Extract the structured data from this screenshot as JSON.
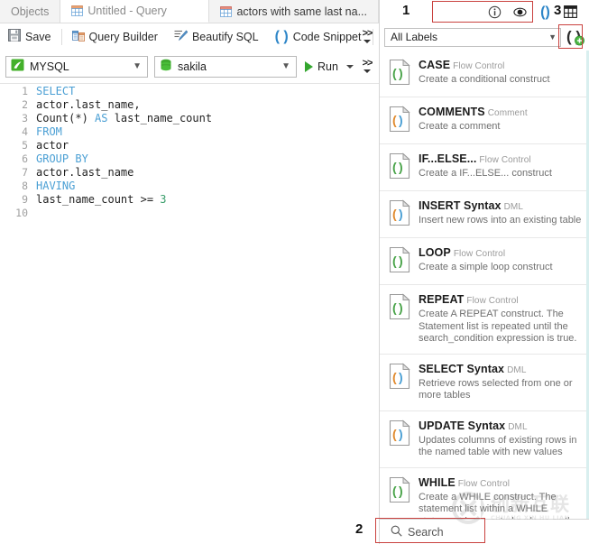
{
  "tabs": [
    {
      "label": "Objects",
      "icon": "none",
      "active": false
    },
    {
      "label": "Untitled - Query",
      "icon": "grid-orange-icon",
      "active": true
    },
    {
      "label": "actors with same last na...",
      "icon": "grid-red-icon",
      "active": false
    }
  ],
  "toolbar": {
    "save_label": "Save",
    "query_builder_label": "Query Builder",
    "beautify_label": "Beautify SQL",
    "code_snippet_label": "Code Snippet",
    "overflow_label": ">>"
  },
  "connection_bar": {
    "connection_value": "MYSQL",
    "database_value": "sakila",
    "run_label": "Run"
  },
  "editor": {
    "lines": [
      {
        "n": "1",
        "tokens": [
          {
            "t": "SELECT",
            "c": "kw"
          }
        ]
      },
      {
        "n": "2",
        "tokens": [
          {
            "t": "actor.last_name,",
            "c": ""
          }
        ]
      },
      {
        "n": "3",
        "tokens": [
          {
            "t": "Count(*) ",
            "c": ""
          },
          {
            "t": "AS",
            "c": "kw"
          },
          {
            "t": " last_name_count",
            "c": ""
          }
        ]
      },
      {
        "n": "4",
        "tokens": [
          {
            "t": "FROM",
            "c": "kw"
          }
        ]
      },
      {
        "n": "5",
        "tokens": [
          {
            "t": "actor",
            "c": ""
          }
        ]
      },
      {
        "n": "6",
        "tokens": [
          {
            "t": "GROUP BY",
            "c": "kw"
          }
        ]
      },
      {
        "n": "7",
        "tokens": [
          {
            "t": "actor.last_name",
            "c": ""
          }
        ]
      },
      {
        "n": "8",
        "tokens": [
          {
            "t": "HAVING",
            "c": "kw"
          }
        ]
      },
      {
        "n": "9",
        "tokens": [
          {
            "t": "last_name_count >= ",
            "c": ""
          },
          {
            "t": "3",
            "c": "num"
          }
        ]
      },
      {
        "n": "10",
        "tokens": []
      }
    ]
  },
  "snippet_panel": {
    "header_icons": [
      "info-icon",
      "eye-icon",
      "parentheses-icon",
      "table-icon"
    ],
    "filter_value": "All Labels",
    "add_snippet_icon": "add-snippet-icon",
    "search_placeholder": "Search",
    "items": [
      {
        "title": "CASE",
        "category": "Flow Control",
        "desc": "Create a conditional construct",
        "icon_color": "green"
      },
      {
        "title": "COMMENTS",
        "category": "Comment",
        "desc": "Create a comment",
        "icon_color": "orange"
      },
      {
        "title": "IF...ELSE...",
        "category": "Flow Control",
        "desc": "Create a IF...ELSE... construct",
        "icon_color": "green"
      },
      {
        "title": "INSERT Syntax",
        "category": "DML",
        "desc": "Insert new rows into an existing table",
        "icon_color": "orange"
      },
      {
        "title": "LOOP",
        "category": "Flow Control",
        "desc": "Create a simple loop construct",
        "icon_color": "green"
      },
      {
        "title": "REPEAT",
        "category": "Flow Control",
        "desc": "Create A REPEAT construct. The Statement list is repeated until the search_condition expression is true.",
        "icon_color": "green"
      },
      {
        "title": "SELECT Syntax",
        "category": "DML",
        "desc": "Retrieve rows selected from one or more tables",
        "icon_color": "orange"
      },
      {
        "title": "UPDATE Syntax",
        "category": "DML",
        "desc": "Updates columns of existing rows in the named table with new values",
        "icon_color": "orange"
      },
      {
        "title": "WHILE",
        "category": "Flow Control",
        "desc": "Create a WHILE construct. The statement list within a WHILE statement is repeated as long as the search  condition expression is true.",
        "icon_color": "green"
      }
    ]
  },
  "annotations": [
    {
      "label": "1"
    },
    {
      "label": "2"
    },
    {
      "label": "3"
    }
  ],
  "watermark": {
    "cn": "创新互联",
    "en": "CHUANG XIN HU LIAN"
  },
  "colors": {
    "accent_green": "#34a62f",
    "annotation_red": "#c9413e",
    "keyword_blue": "#4a9fd4",
    "number_green": "#3a9e6b"
  }
}
